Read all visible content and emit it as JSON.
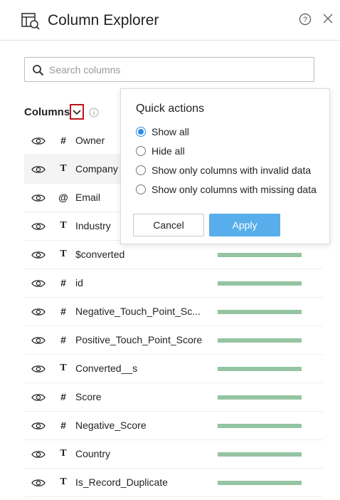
{
  "header": {
    "title": "Column Explorer",
    "icon": "table-search-icon"
  },
  "search": {
    "placeholder": "Search columns",
    "value": ""
  },
  "columns_header": {
    "label": "Columns"
  },
  "rows": [
    {
      "type": "#",
      "name": "Owner",
      "has_bar": false
    },
    {
      "type": "T",
      "name": "Company",
      "has_bar": false
    },
    {
      "type": "@",
      "name": "Email",
      "has_bar": false
    },
    {
      "type": "T",
      "name": "Industry",
      "has_bar": false
    },
    {
      "type": "T",
      "name": "$converted",
      "has_bar": true
    },
    {
      "type": "#",
      "name": "id",
      "has_bar": true
    },
    {
      "type": "#",
      "name": "Negative_Touch_Point_Sc...",
      "has_bar": true
    },
    {
      "type": "#",
      "name": "Positive_Touch_Point_Score",
      "has_bar": true
    },
    {
      "type": "T",
      "name": "Converted__s",
      "has_bar": true
    },
    {
      "type": "#",
      "name": "Score",
      "has_bar": true
    },
    {
      "type": "#",
      "name": "Negative_Score",
      "has_bar": true
    },
    {
      "type": "T",
      "name": "Country",
      "has_bar": true
    },
    {
      "type": "T",
      "name": "Is_Record_Duplicate",
      "has_bar": true
    }
  ],
  "quick_actions": {
    "title": "Quick actions",
    "options": [
      {
        "label": "Show all",
        "selected": true
      },
      {
        "label": "Hide all",
        "selected": false
      },
      {
        "label": "Show only columns with invalid data",
        "selected": false
      },
      {
        "label": "Show only columns with missing data",
        "selected": false
      }
    ],
    "cancel_label": "Cancel",
    "apply_label": "Apply"
  },
  "colors": {
    "accent": "#2b8fe6",
    "apply_bg": "#57aeea",
    "quality_bar": "#94c4a2",
    "highlight_border": "#c0141b"
  }
}
